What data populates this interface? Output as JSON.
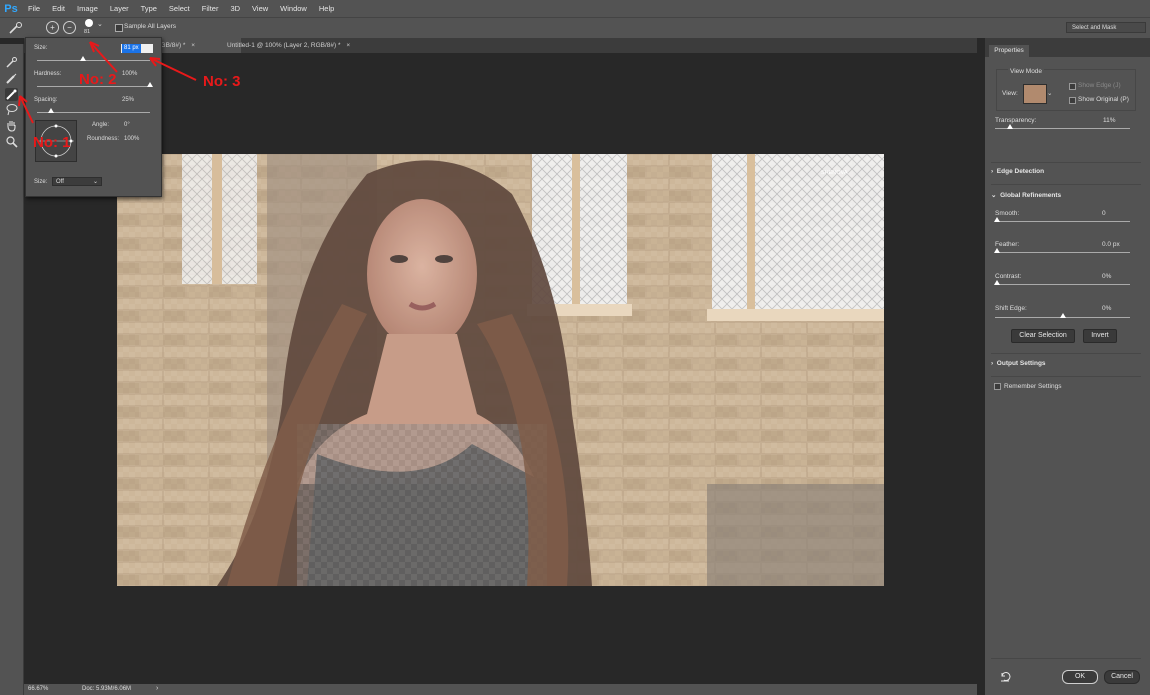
{
  "app": {
    "logo": "Ps"
  },
  "menubar": {
    "items": [
      "File",
      "Edit",
      "Image",
      "Layer",
      "Type",
      "Select",
      "Filter",
      "3D",
      "View",
      "Window",
      "Help"
    ]
  },
  "optionsbar": {
    "brush_size": "81",
    "sample_all_layers_label": "Sample All Layers",
    "select_mask_label": "Select and Mask",
    "chevron": "⌄"
  },
  "tabs": [
    {
      "label": "nd, RGB/8#) *",
      "close": "×"
    },
    {
      "label": "Untitled-1 @ 100% (Layer 2, RGB/8#) *",
      "close": "×"
    }
  ],
  "brush_popup": {
    "size_label": "Size:",
    "size_value": "81 px",
    "hardness_label": "Hardness:",
    "hardness_value": "100%",
    "spacing_label": "Spacing:",
    "spacing_value": "25%",
    "angle_label": "Angle:",
    "angle_value": "0°",
    "roundness_label": "Roundness:",
    "roundness_value": "100%",
    "size_mode_label": "Size:",
    "size_mode_value": "Off",
    "size_fraction": 0.41,
    "hardness_fraction": 1.0,
    "spacing_fraction": 0.12
  },
  "annotations": {
    "no1": "No: 1",
    "no2": "No: 2",
    "no3": "No: 3",
    "color": "#e8191a"
  },
  "status": {
    "zoom": "66.67%",
    "doc": "Doc: 5.93M/6.06M",
    "arrow": "›"
  },
  "properties": {
    "tab_label": "Properties",
    "view_mode_label": "View Mode",
    "view_label": "View:",
    "show_edge_label": "Show Edge (J)",
    "show_original_label": "Show Original (P)",
    "transparency_label": "Transparency:",
    "transparency_value": "11%",
    "edge_detection_label": "Edge Detection",
    "global_refinements_label": "Global Refinements",
    "smooth_label": "Smooth:",
    "smooth_value": "0",
    "feather_label": "Feather:",
    "feather_value": "0.0 px",
    "contrast_label": "Contrast:",
    "contrast_value": "0%",
    "shift_edge_label": "Shift Edge:",
    "shift_edge_value": "0%",
    "clear_selection_label": "Clear Selection",
    "invert_label": "Invert",
    "output_settings_label": "Output Settings",
    "remember_settings_label": "Remember Settings",
    "ok_label": "OK",
    "cancel_label": "Cancel",
    "transparency_fraction": 0.11,
    "shift_edge_fraction": 0.5
  },
  "photo": {
    "watermark": "SHENOVA"
  }
}
